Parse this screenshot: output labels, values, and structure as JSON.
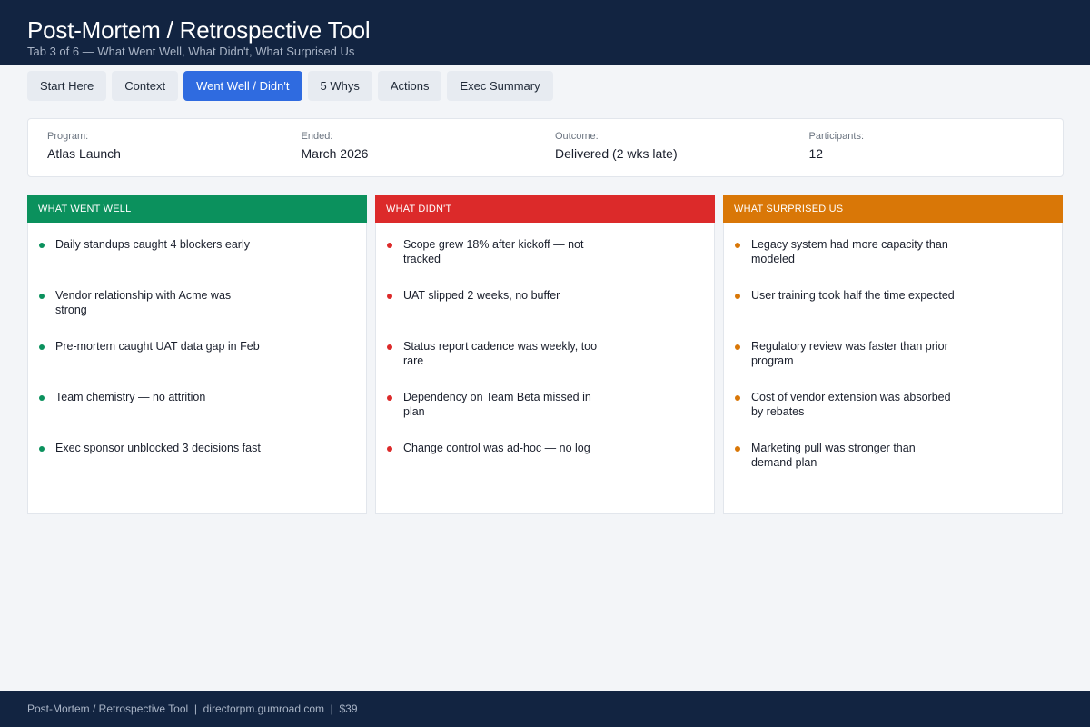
{
  "header": {
    "title": "Post-Mortem / Retrospective Tool",
    "subtitle": "Tab 3 of 6 — What Went Well, What Didn't, What Surprised Us"
  },
  "tabs": [
    {
      "label": "Start Here",
      "active": false
    },
    {
      "label": "Context",
      "active": false
    },
    {
      "label": "Went Well / Didn't",
      "active": true
    },
    {
      "label": "5 Whys",
      "active": false
    },
    {
      "label": "Actions",
      "active": false
    },
    {
      "label": "Exec Summary",
      "active": false
    }
  ],
  "meta": [
    {
      "label": "Program:",
      "value": "Atlas Launch"
    },
    {
      "label": "Ended:",
      "value": "March 2026"
    },
    {
      "label": "Outcome:",
      "value": "Delivered (2 wks late)"
    },
    {
      "label": "Participants:",
      "value": "12"
    }
  ],
  "columns": {
    "well": {
      "title": "WHAT WENT WELL",
      "color": "#0b915d",
      "items": [
        "Daily standups caught 4 blockers early",
        "Vendor relationship with Acme was strong",
        "Pre-mortem caught UAT data gap in Feb",
        "Team chemistry — no attrition",
        "Exec sponsor unblocked 3 decisions fast"
      ]
    },
    "didnt": {
      "title": "WHAT DIDN'T",
      "color": "#dc2a2a",
      "items": [
        "Scope grew 18% after kickoff — not tracked",
        "UAT slipped 2 weeks, no buffer",
        "Status report cadence was weekly, too rare",
        "Dependency on Team Beta missed in plan",
        "Change control was ad-hoc — no log"
      ]
    },
    "surprise": {
      "title": "WHAT SURPRISED US",
      "color": "#d97707",
      "items": [
        "Legacy system had more capacity than modeled",
        "User training took half the time expected",
        "Regulatory review was faster than prior program",
        "Cost of vendor extension was absorbed by rebates",
        "Marketing pull was stronger than demand plan"
      ]
    }
  },
  "footer": {
    "text": "Post-Mortem / Retrospective Tool  |  directorpm.gumroad.com  |  $39"
  }
}
